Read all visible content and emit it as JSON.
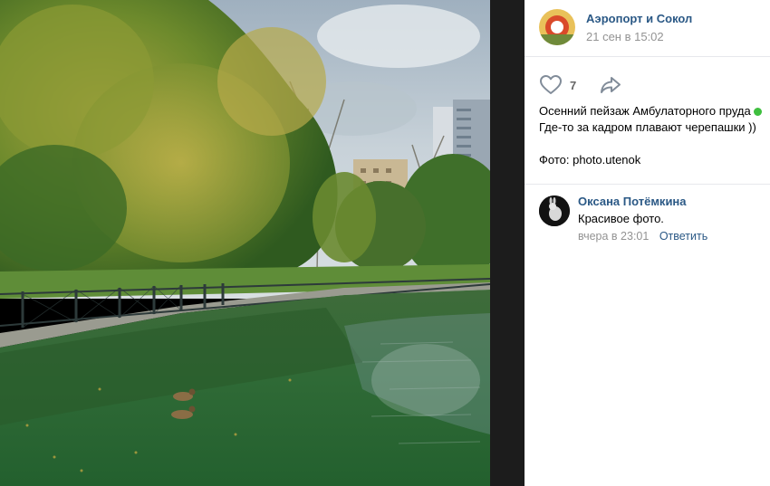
{
  "post": {
    "group_name": "Аэропорт и Сокол",
    "date": "21 сен в 15:02",
    "likes": "7",
    "text_line1": "Осенний пейзаж Амбулаторного пруда",
    "text_line2": "Где-то за кадром плавают черепашки ))",
    "text_line3": "Фото: photo.utenok"
  },
  "comment": {
    "author": "Оксана Потёмкина",
    "text": "Красивое фото.",
    "time": "вчера в 23:01",
    "reply_label": "Ответить"
  },
  "icons": {
    "like": "heart-icon",
    "share": "share-arrow-icon",
    "emoji": "green-circle-emoji"
  },
  "colors": {
    "link": "#2a5885",
    "meta": "#939393",
    "divider": "#e7e8ec"
  }
}
